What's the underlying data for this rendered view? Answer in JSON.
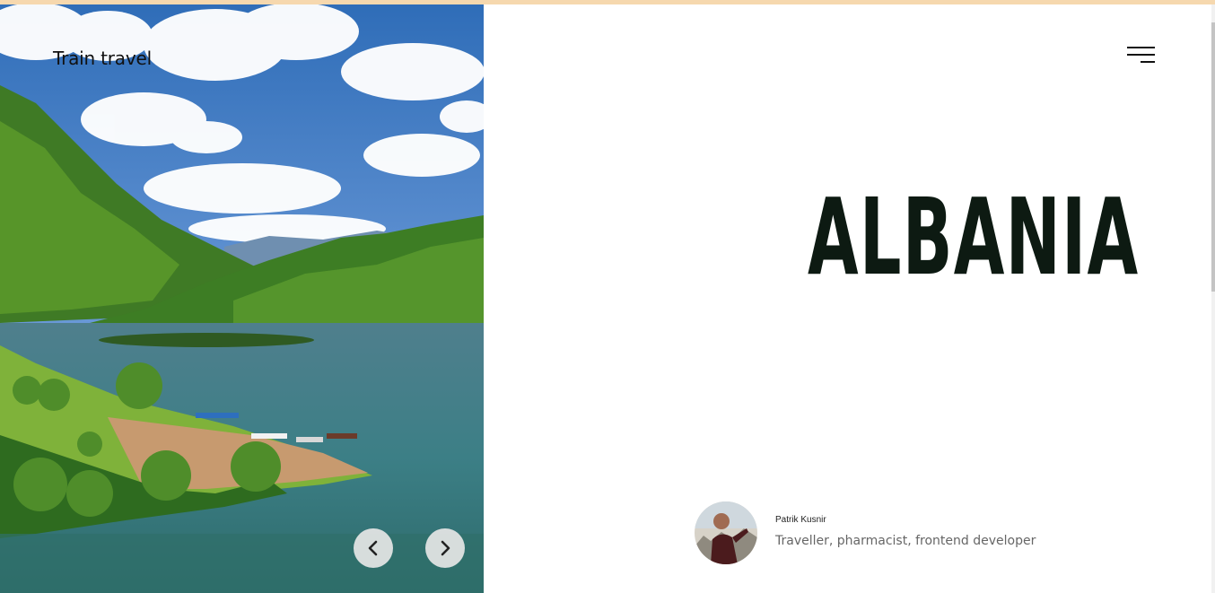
{
  "header": {
    "brand": "Train travel",
    "menu_icon": "hamburger-menu-icon"
  },
  "hero": {
    "image": "mountain-lake-landscape",
    "prev_icon": "chevron-left-icon",
    "next_icon": "chevron-right-icon"
  },
  "main": {
    "title": "ALBANIA"
  },
  "author": {
    "name": "Patrik Kusnir",
    "bio": "Traveller, pharmacist, frontend developer",
    "avatar": "author-avatar"
  },
  "colors": {
    "accent_top": "#f6d8ae",
    "title": "#0d1a12",
    "sky": "#4f83c9",
    "water": "#3d7f86"
  }
}
